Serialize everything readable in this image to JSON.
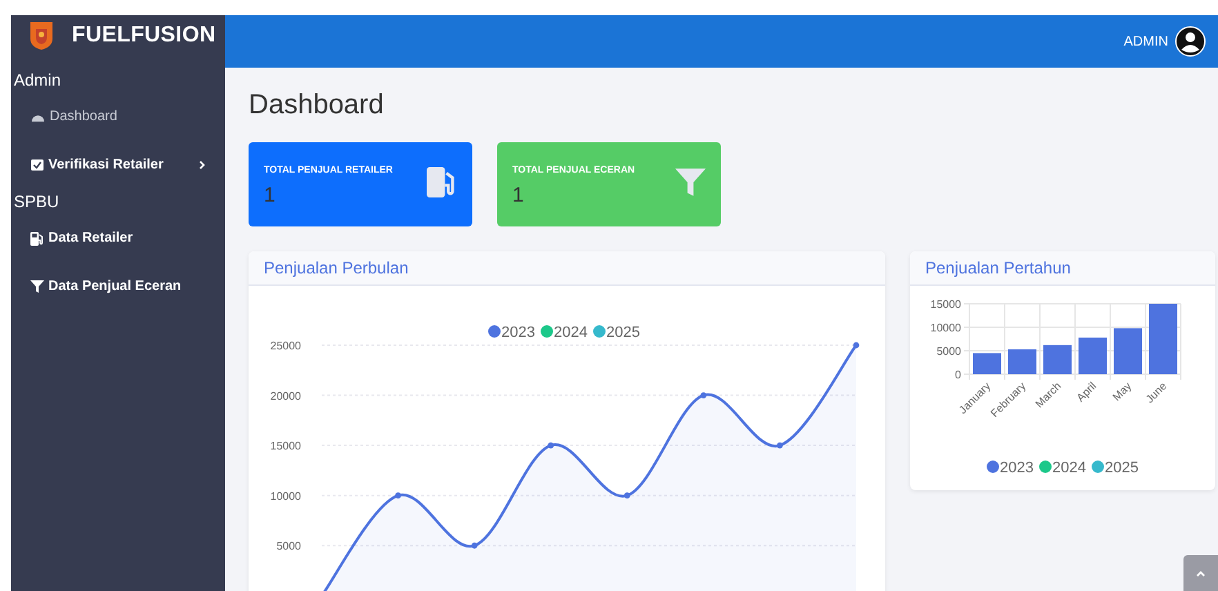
{
  "sidebar": {
    "brand": "FUELFUSION",
    "sections": [
      {
        "heading": "Admin",
        "items": [
          {
            "label": "Dashboard",
            "kind": "gauge",
            "selected": true,
            "expandable": false
          },
          {
            "label": "Verifikasi Retailer",
            "kind": "check",
            "selected": false,
            "expandable": true
          }
        ]
      },
      {
        "heading": "SPBU",
        "items": [
          {
            "label": "Data Retailer",
            "kind": "pump",
            "selected": false,
            "expandable": false
          },
          {
            "label": "Data Penjual Eceran",
            "kind": "filter",
            "selected": false,
            "expandable": false
          }
        ]
      }
    ]
  },
  "topbar": {
    "user": "ADMIN"
  },
  "page_title": "Dashboard",
  "stat_cards": [
    {
      "label": "TOTAL PENJUAL RETAILER",
      "value": "1",
      "color": "#0d6efd",
      "kind": "pump"
    },
    {
      "label": "TOTAL PENJUAL ECERAN",
      "value": "1",
      "color": "#55cc66",
      "kind": "filter"
    }
  ],
  "charts": [
    {
      "title": "Penjualan Perbulan",
      "chart_data": {
        "type": "area",
        "grid": true,
        "categories": [
          null,
          null,
          null,
          null,
          null,
          null,
          null,
          null
        ],
        "ylim": [
          0,
          25000
        ],
        "yticks": [
          5000,
          10000,
          15000,
          20000,
          25000
        ],
        "series": [
          {
            "name": "2023",
            "color": "#4e73df",
            "marker": true,
            "values": [
              0,
              10000,
              5000,
              15000,
              10000,
              20000,
              15000,
              25000
            ]
          },
          {
            "name": "2024",
            "color": "#1cc88a",
            "values": [
              null,
              null,
              null,
              null,
              null,
              null,
              null,
              null
            ]
          },
          {
            "name": "2025",
            "color": "#36b9cc",
            "values": [
              null,
              null,
              null,
              null,
              null,
              null,
              null,
              null
            ]
          }
        ]
      }
    },
    {
      "title": "Penjualan Pertahun",
      "chart_data": {
        "type": "bar",
        "grid": true,
        "categories": [
          "January",
          "February",
          "March",
          "April",
          "May",
          "June"
        ],
        "ylim": [
          0,
          15000
        ],
        "yticks": [
          0,
          5000,
          10000,
          15000
        ],
        "series": [
          {
            "name": "2023",
            "color": "#4e73df",
            "values": [
              4500,
              5300,
              6200,
              7800,
              9800,
              15000
            ]
          },
          {
            "name": "2024",
            "color": "#1cc88a",
            "values": [
              null,
              null,
              null,
              null,
              null,
              null
            ]
          },
          {
            "name": "2025",
            "color": "#36b9cc",
            "values": [
              null,
              null,
              null,
              null,
              null,
              null
            ]
          }
        ]
      }
    }
  ]
}
